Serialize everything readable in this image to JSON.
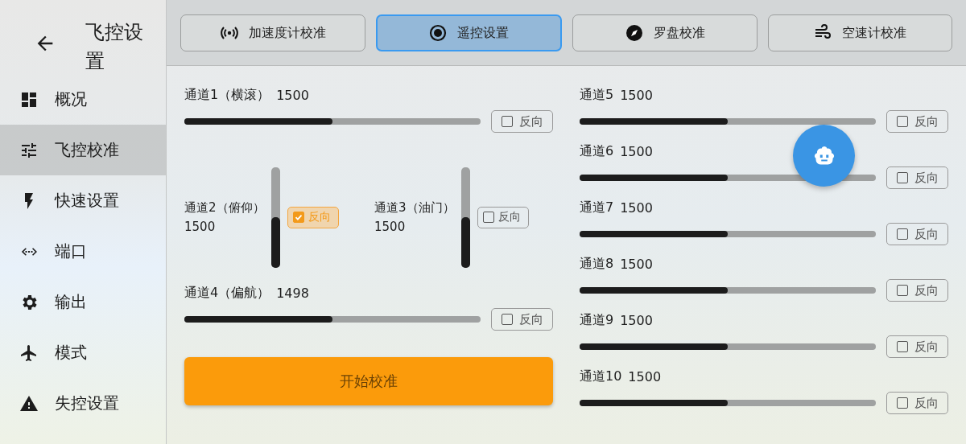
{
  "sidebar": {
    "title": "飞控设置",
    "items": [
      {
        "label": "概况",
        "selected": false
      },
      {
        "label": "飞控校准",
        "selected": true
      },
      {
        "label": "快速设置",
        "selected": false
      },
      {
        "label": "端口",
        "selected": false
      },
      {
        "label": "输出",
        "selected": false
      },
      {
        "label": "模式",
        "selected": false
      },
      {
        "label": "失控设置",
        "selected": false
      }
    ]
  },
  "tabs": [
    {
      "label": "加速度计校准",
      "selected": false
    },
    {
      "label": "遥控设置",
      "selected": true
    },
    {
      "label": "罗盘校准",
      "selected": false
    },
    {
      "label": "空速计校准",
      "selected": false
    }
  ],
  "left_channels": [
    {
      "kind": "horizontal",
      "name": "通道1（横滚）",
      "value": "1500",
      "level": 0.5,
      "reverse": {
        "label": "反向",
        "checked": false
      }
    },
    {
      "kind": "vertical",
      "name": "通道2（俯仰）",
      "value": "1500",
      "level": 0.5,
      "reverse": {
        "label": "反向",
        "checked": true
      }
    },
    {
      "kind": "vertical",
      "name": "通道3（油门）",
      "value": "1500",
      "level": 0.5,
      "reverse": {
        "label": "反向",
        "checked": false
      }
    },
    {
      "kind": "horizontal",
      "name": "通道4（偏航）",
      "value": "1498",
      "level": 0.5,
      "reverse": {
        "label": "反向",
        "checked": false
      }
    }
  ],
  "start_button": "开始校准",
  "right_channels": [
    {
      "kind": "horizontal",
      "name": "通道5",
      "value": "1500",
      "level": 0.5,
      "reverse": {
        "label": "反向",
        "checked": false
      }
    },
    {
      "kind": "horizontal",
      "name": "通道6",
      "value": "1500",
      "level": 0.5,
      "reverse": {
        "label": "反向",
        "checked": false
      }
    },
    {
      "kind": "horizontal",
      "name": "通道7",
      "value": "1500",
      "level": 0.5,
      "reverse": {
        "label": "反向",
        "checked": false
      }
    },
    {
      "kind": "horizontal",
      "name": "通道8",
      "value": "1500",
      "level": 0.5,
      "reverse": {
        "label": "反向",
        "checked": false
      }
    },
    {
      "kind": "horizontal",
      "name": "通道9",
      "value": "1500",
      "level": 0.5,
      "reverse": {
        "label": "反向",
        "checked": false
      }
    },
    {
      "kind": "horizontal",
      "name": "通道10",
      "value": "1500",
      "level": 0.5,
      "reverse": {
        "label": "反向",
        "checked": false
      }
    }
  ]
}
